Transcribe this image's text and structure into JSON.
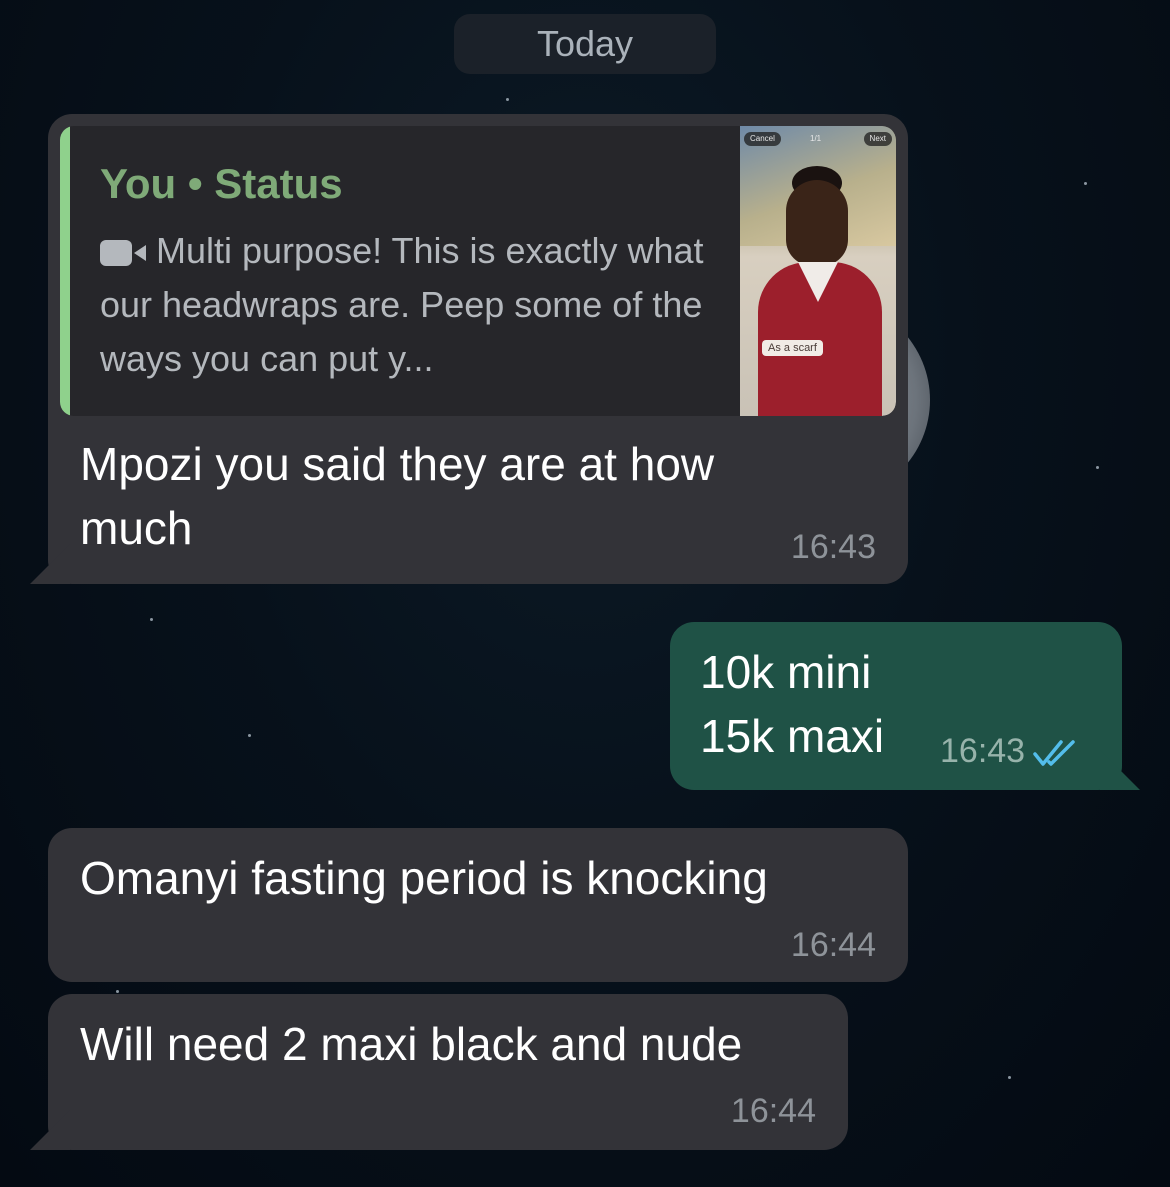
{
  "date_divider": "Today",
  "messages": [
    {
      "direction": "incoming",
      "quote": {
        "title": "You • Status",
        "icon": "video-camera-icon",
        "text": "Multi purpose! This is exactly what our headwraps are. Peep some of the ways you can put y...",
        "thumb": {
          "cancel": "Cancel",
          "counter": "1/1",
          "next": "Next",
          "tag": "As a scarf"
        }
      },
      "text": "Mpozi you said they are at how much",
      "time": "16:43"
    },
    {
      "direction": "outgoing",
      "text": "10k mini\n15k maxi",
      "time": "16:43",
      "status": "read",
      "status_color": "#53bdeb"
    },
    {
      "direction": "incoming",
      "text": "Omanyi fasting period is knocking",
      "time": "16:44"
    },
    {
      "direction": "incoming",
      "text": "Will need 2 maxi black and nude",
      "time": "16:44"
    }
  ]
}
